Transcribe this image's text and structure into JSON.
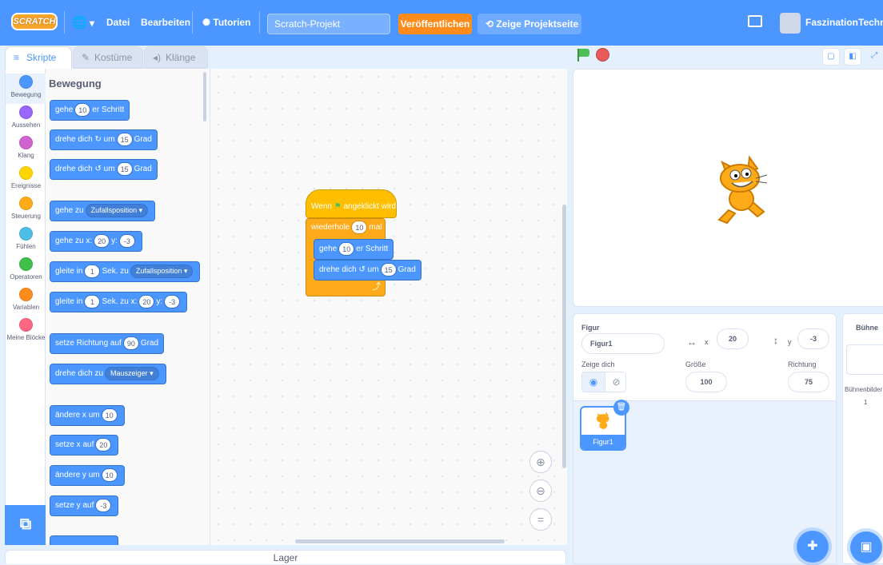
{
  "menu": {
    "logo": "SCRATCH",
    "language_caret": "▾",
    "file": "Datei",
    "edit": "Bearbeiten",
    "tutorials": "Tutorien",
    "project_title": "Scratch-Projekt",
    "publish": "Veröffentlichen",
    "see_project_page": "Zeige Projektseite",
    "username": "FaszinationTechnik"
  },
  "tabs": [
    {
      "label": "Skripte"
    },
    {
      "label": "Kostüme"
    },
    {
      "label": "Klänge"
    }
  ],
  "categories": [
    {
      "label": "Bewegung",
      "color": "#4c97ff"
    },
    {
      "label": "Aussehen",
      "color": "#9966ff"
    },
    {
      "label": "Klang",
      "color": "#cf63cf"
    },
    {
      "label": "Ereignisse",
      "color": "#ffd500"
    },
    {
      "label": "Steuerung",
      "color": "#ffab19"
    },
    {
      "label": "Fühlen",
      "color": "#4cbfe6"
    },
    {
      "label": "Operatoren",
      "color": "#40bf4a"
    },
    {
      "label": "Variablen",
      "color": "#ff8c1a"
    },
    {
      "label": "Meine Blöcke",
      "color": "#ff6680"
    }
  ],
  "palette": {
    "section_title": "Bewegung",
    "blocks": {
      "move": {
        "a": "gehe",
        "v": "10",
        "b": "er Schritt"
      },
      "turn_right": {
        "a": "drehe dich",
        "b": "um",
        "v": "15",
        "c": "Grad"
      },
      "turn_left": {
        "a": "drehe dich",
        "b": "um",
        "v": "15",
        "c": "Grad"
      },
      "goto": {
        "a": "gehe zu",
        "dd": "Zufallsposition"
      },
      "goto_xy": {
        "a": "gehe zu x:",
        "x": "20",
        "b": "y:",
        "y": "-3"
      },
      "glide_to": {
        "a": "gleite in",
        "v": "1",
        "b": "Sek. zu",
        "dd": "Zufallsposition"
      },
      "glide_xy": {
        "a": "gleite in",
        "v": "1",
        "b": "Sek. zu x:",
        "x": "20",
        "c": "y:",
        "y": "-3"
      },
      "point_dir": {
        "a": "setze Richtung auf",
        "v": "90",
        "b": "Grad"
      },
      "point_towards": {
        "a": "drehe dich zu",
        "dd": "Mauszeiger"
      },
      "change_x": {
        "a": "ändere x um",
        "v": "10"
      },
      "set_x": {
        "a": "setze x auf",
        "v": "20"
      },
      "change_y": {
        "a": "ändere y um",
        "v": "10"
      },
      "set_y": {
        "a": "setze y auf",
        "v": "-3"
      }
    }
  },
  "script": {
    "hat": {
      "a": "Wenn",
      "b": "angeklickt wird"
    },
    "repeat": {
      "a": "wiederhole",
      "v": "10",
      "b": "mal"
    },
    "move": {
      "a": "gehe",
      "v": "10",
      "b": "er Schritt"
    },
    "turn": {
      "a": "drehe dich",
      "b": "um",
      "v": "15",
      "c": "Grad"
    }
  },
  "lager": "Lager",
  "sprite_info": {
    "figur_label": "Figur",
    "name": "Figur1",
    "x_label": "x",
    "x": "20",
    "y_label": "y",
    "y": "-3",
    "show_label": "Zeige dich",
    "size_label": "Größe",
    "size": "100",
    "direction_label": "Richtung",
    "direction": "75"
  },
  "sprites": [
    {
      "name": "Figur1"
    }
  ],
  "stage_panel": {
    "title": "Bühne",
    "backdrops_label": "Bühnenbilder",
    "backdrops_count": "1"
  }
}
